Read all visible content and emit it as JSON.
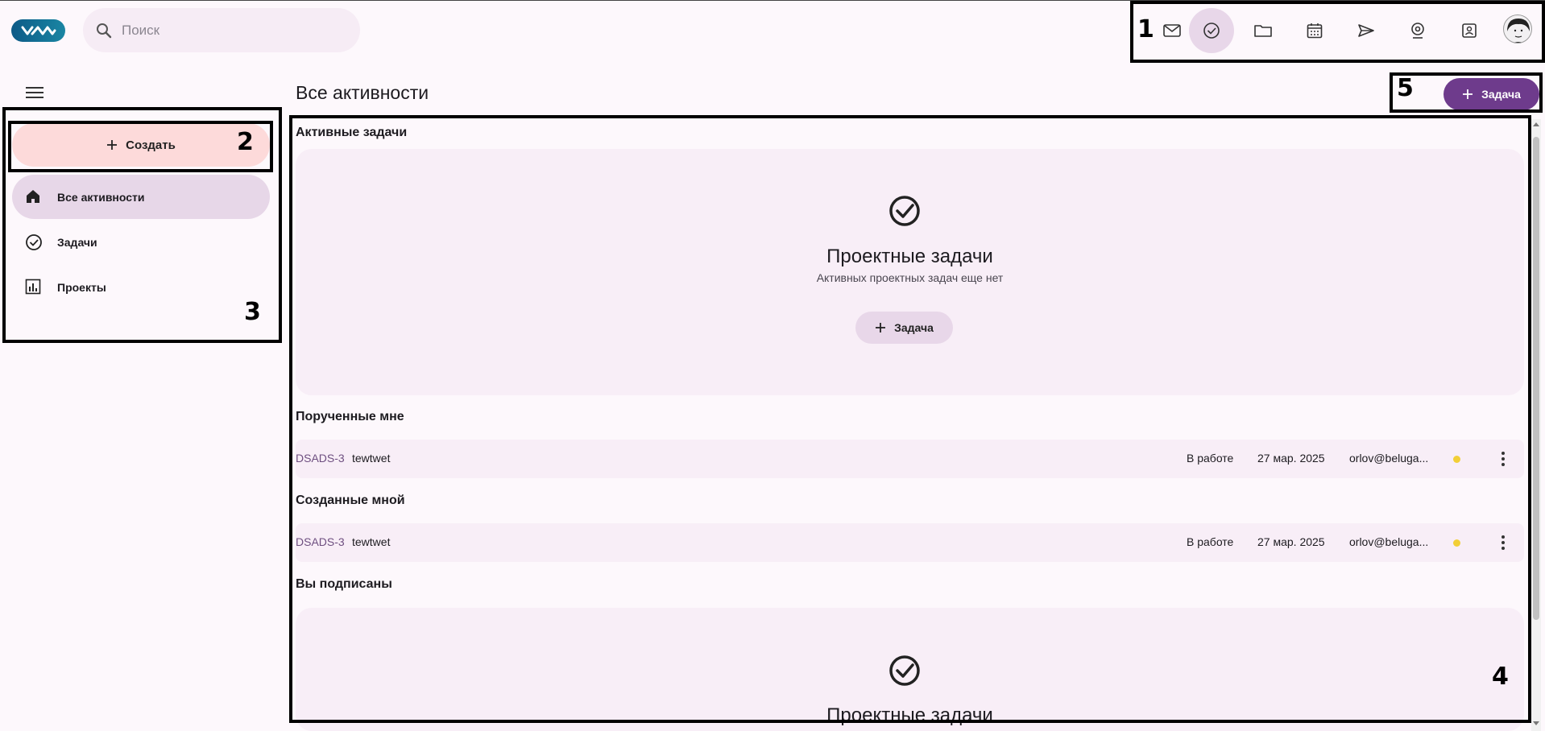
{
  "header": {
    "search_placeholder": "Поиск",
    "app_icons": [
      "mail-icon",
      "tasks-icon",
      "folder-icon",
      "calendar-icon",
      "send-icon",
      "webcam-icon",
      "contacts-icon"
    ],
    "active_app": "tasks-icon"
  },
  "sidebar": {
    "create_label": "Создать",
    "items": [
      {
        "label": "Все активности",
        "icon": "home-icon",
        "active": true
      },
      {
        "label": "Задачи",
        "icon": "check-circle-icon",
        "active": false
      },
      {
        "label": "Проекты",
        "icon": "chart-icon",
        "active": false
      }
    ]
  },
  "main": {
    "title": "Все активности",
    "task_button_label": "Задача",
    "sections": {
      "active": {
        "title": "Активные задачи",
        "empty_title": "Проектные задачи",
        "empty_subtitle": "Активных проектных задач еще нет",
        "empty_button": "Задача"
      },
      "assigned": {
        "title": "Порученные мне",
        "rows": [
          {
            "id": "DSADS-3",
            "name": "tewtwet",
            "status": "В работе",
            "date": "27 мар. 2025",
            "user": "orlov@beluga..."
          }
        ]
      },
      "created": {
        "title": "Созданные мной",
        "rows": [
          {
            "id": "DSADS-3",
            "name": "tewtwet",
            "status": "В работе",
            "date": "27 мар. 2025",
            "user": "orlov@beluga..."
          }
        ]
      },
      "subscribed": {
        "title": "Вы подписаны",
        "empty_title": "Проектные задачи"
      }
    }
  },
  "annotations": [
    "1",
    "2",
    "3",
    "4",
    "5"
  ],
  "colors": {
    "accent": "#6e3b8c",
    "create_bg": "#fddada",
    "active_nav_bg": "#e7d7e8",
    "card_bg": "#f8eef7",
    "status_dot": "#f2cf37"
  }
}
